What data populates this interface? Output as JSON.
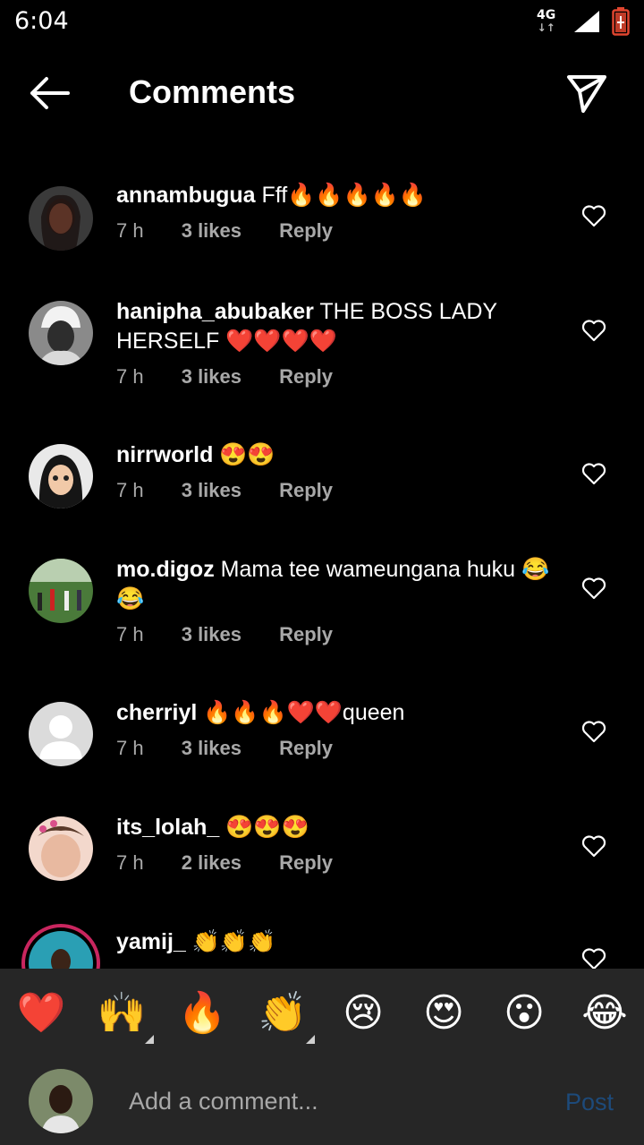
{
  "status_bar": {
    "time": "6:04",
    "network": "4G"
  },
  "header": {
    "title": "Comments"
  },
  "comments": [
    {
      "username": "annambugua",
      "text": "Fff🔥🔥🔥🔥🔥",
      "time": "7 h",
      "likes": "3 likes",
      "reply": "Reply"
    },
    {
      "username": "hanipha_abubaker",
      "text": "THE BOSS LADY HERSELF ❤️❤️❤️❤️",
      "time": "7 h",
      "likes": "3 likes",
      "reply": "Reply"
    },
    {
      "username": "nirrworld",
      "text": "😍😍",
      "time": "7 h",
      "likes": "3 likes",
      "reply": "Reply"
    },
    {
      "username": "mo.digoz",
      "text": "Mama tee wameungana huku 😂😂",
      "time": "7 h",
      "likes": "3 likes",
      "reply": "Reply"
    },
    {
      "username": "cherriyl",
      "text": "🔥🔥🔥❤️❤️queen",
      "time": "7 h",
      "likes": "3 likes",
      "reply": "Reply"
    },
    {
      "username": "its_lolah_",
      "text": "😍😍😍",
      "time": "7 h",
      "likes": "2 likes",
      "reply": "Reply"
    },
    {
      "username": "yamij_",
      "text": "👏👏👏",
      "time": "",
      "likes": "",
      "reply": ""
    }
  ],
  "emoji_tray": [
    "❤️",
    "🙌",
    "🔥",
    "👏",
    "😢",
    "😍",
    "😮",
    "😂"
  ],
  "composer": {
    "placeholder": "Add a comment...",
    "post_label": "Post"
  },
  "colors": {
    "background": "#000000",
    "tray": "#262626",
    "secondary_text": "#a8a8a8",
    "post_disabled": "#1d4a7a"
  }
}
